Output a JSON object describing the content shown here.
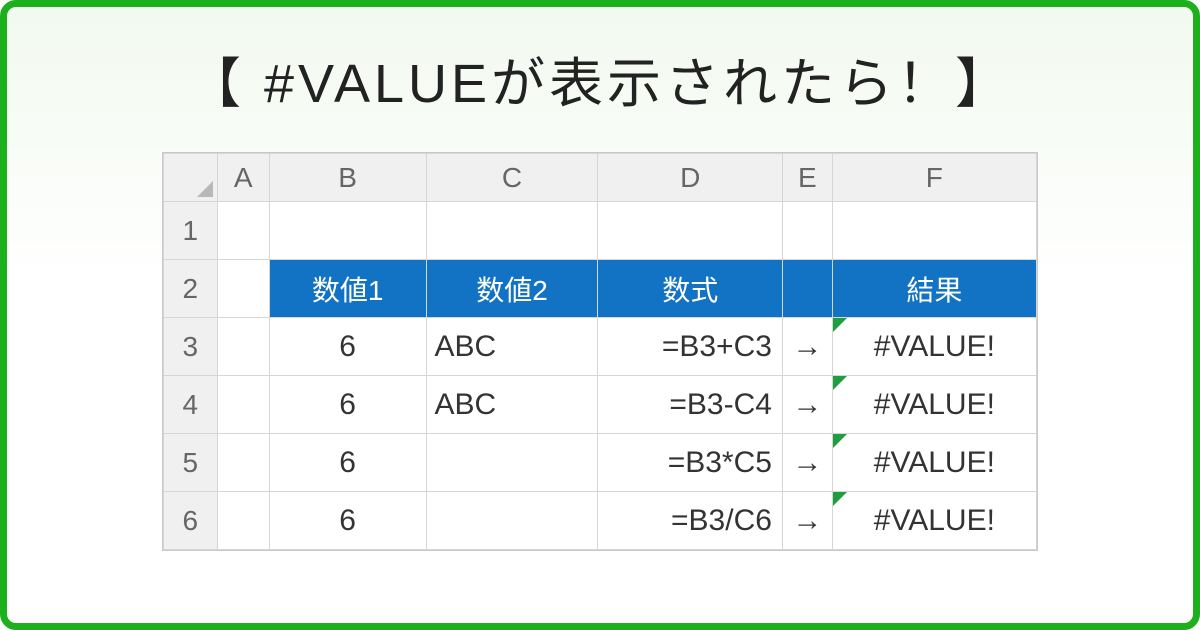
{
  "title": "【 #VALUEが表示されたら！】",
  "columns": [
    "A",
    "B",
    "C",
    "D",
    "E",
    "F"
  ],
  "rowNumbers": [
    "1",
    "2",
    "3",
    "4",
    "5",
    "6"
  ],
  "headerRow": {
    "B": "数値1",
    "C": "数値2",
    "D": "数式",
    "F": "結果"
  },
  "arrow": "→",
  "rows": [
    {
      "B": "6",
      "C": "ABC",
      "D": "=B3+C3",
      "F": "#VALUE!"
    },
    {
      "B": "6",
      "C": "ABC",
      "D": "=B3-C4",
      "F": "#VALUE!"
    },
    {
      "B": "6",
      "C": "",
      "D": "=B3*C5",
      "F": "#VALUE!"
    },
    {
      "B": "6",
      "C": "",
      "D": "=B3/C6",
      "F": "#VALUE!"
    }
  ]
}
